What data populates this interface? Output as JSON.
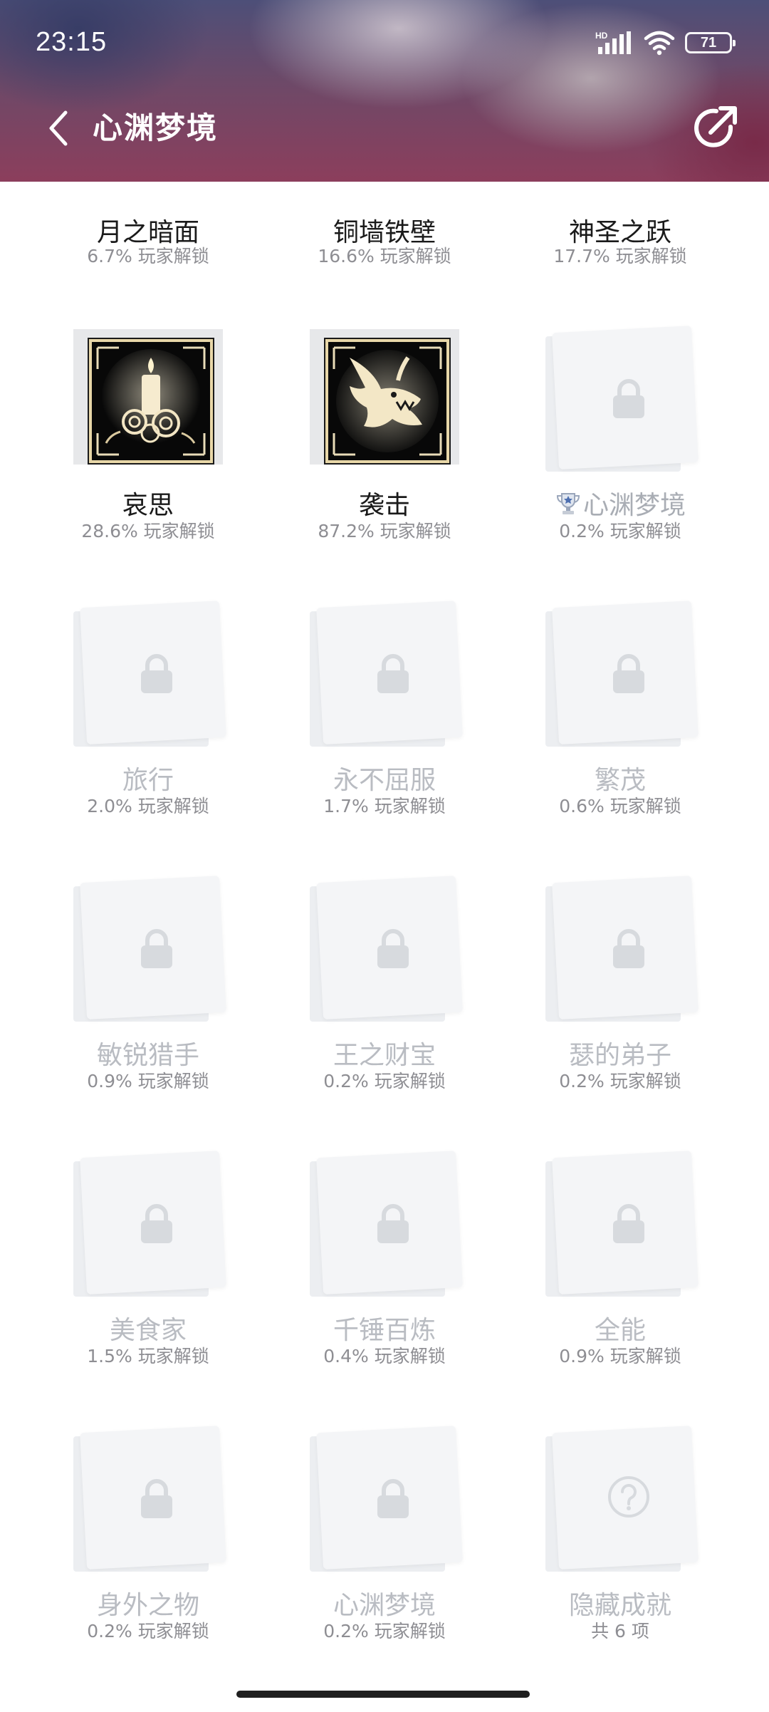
{
  "status_bar": {
    "time": "23:15",
    "network_label": "HD",
    "battery": "71"
  },
  "nav": {
    "title": "心渊梦境",
    "back_icon": "chevron-left-icon",
    "share_icon": "share-icon"
  },
  "achievements": [
    {
      "name": "月之暗面",
      "stat": "6.7% 玩家解锁",
      "state": "unlocked"
    },
    {
      "name": "铜墙铁壁",
      "stat": "16.6% 玩家解锁",
      "state": "unlocked"
    },
    {
      "name": "神圣之跃",
      "stat": "17.7% 玩家解锁",
      "state": "unlocked"
    },
    {
      "name": "哀思",
      "stat": "28.6% 玩家解锁",
      "state": "unlocked",
      "icon": "candle-roses-icon"
    },
    {
      "name": "袭击",
      "stat": "87.2% 玩家解锁",
      "state": "unlocked",
      "icon": "dragon-head-icon"
    },
    {
      "name": "心渊梦境",
      "stat": "0.2% 玩家解锁",
      "state": "locked",
      "icon": "trophy-icon"
    },
    {
      "name": "旅行",
      "stat": "2.0% 玩家解锁",
      "state": "locked"
    },
    {
      "name": "永不屈服",
      "stat": "1.7% 玩家解锁",
      "state": "locked"
    },
    {
      "name": "繁茂",
      "stat": "0.6% 玩家解锁",
      "state": "locked"
    },
    {
      "name": "敏锐猎手",
      "stat": "0.9% 玩家解锁",
      "state": "locked"
    },
    {
      "name": "王之财宝",
      "stat": "0.2% 玩家解锁",
      "state": "locked"
    },
    {
      "name": "瑟的弟子",
      "stat": "0.2% 玩家解锁",
      "state": "locked"
    },
    {
      "name": "美食家",
      "stat": "1.5% 玩家解锁",
      "state": "locked"
    },
    {
      "name": "千锤百炼",
      "stat": "0.4% 玩家解锁",
      "state": "locked"
    },
    {
      "name": "全能",
      "stat": "0.9% 玩家解锁",
      "state": "locked"
    },
    {
      "name": "身外之物",
      "stat": "0.2% 玩家解锁",
      "state": "locked"
    },
    {
      "name": "心渊梦境",
      "stat": "0.2% 玩家解锁",
      "state": "locked"
    },
    {
      "name": "隐藏成就",
      "stat": "共 6 项",
      "state": "hidden"
    }
  ],
  "colors": {
    "locked_text": "#b9bcc2",
    "unlocked_text": "#1a1a1a",
    "stat_text": "#8e8e93",
    "badge_gold": "#e8d7a8"
  }
}
